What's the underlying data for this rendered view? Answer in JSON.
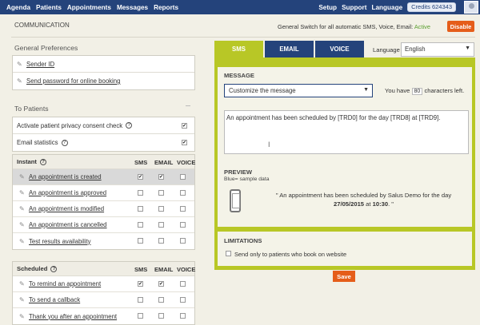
{
  "nav": {
    "left": [
      "Agenda",
      "Patients",
      "Appointments",
      "Messages",
      "Reports"
    ],
    "right": [
      "Setup",
      "Support",
      "Language"
    ],
    "credits": "Credits 624343"
  },
  "header": {
    "title": "COMMUNICATION",
    "switch_text": "General Switch for all automatic SMS, Voice, Email:",
    "switch_status": "Active",
    "disable_label": "Disable"
  },
  "general": {
    "title": "General Preferences",
    "items": [
      "Sender ID",
      "Send password for online booking"
    ]
  },
  "patients": {
    "title": "To Patients",
    "options": [
      {
        "label": "Activate patient privacy consent check",
        "checked": true
      },
      {
        "label": "Email statistics",
        "checked": true
      }
    ]
  },
  "instant": {
    "title": "Instant",
    "cols": [
      "SMS",
      "EMAIL",
      "VOICE"
    ],
    "rows": [
      {
        "label": "An appointment is created",
        "sms": true,
        "email": true,
        "voice": false
      },
      {
        "label": "An appointment is approved",
        "sms": false,
        "email": false,
        "voice": false
      },
      {
        "label": "An appointment is modified",
        "sms": false,
        "email": false,
        "voice": false
      },
      {
        "label": "An appointment is cancelled",
        "sms": false,
        "email": false,
        "voice": false
      },
      {
        "label": "Test results availability",
        "sms": false,
        "email": false,
        "voice": false
      }
    ]
  },
  "scheduled": {
    "title": "Scheduled",
    "cols": [
      "SMS",
      "EMAIL",
      "VOICE"
    ],
    "rows": [
      {
        "label": "To remind an appointment",
        "sms": true,
        "email": true,
        "voice": false
      },
      {
        "label": "To send a callback",
        "sms": false,
        "email": false,
        "voice": false
      },
      {
        "label": "Thank you after an appointment",
        "sms": false,
        "email": false,
        "voice": false
      }
    ]
  },
  "tabs": [
    "SMS",
    "EMAIL",
    "VOICE"
  ],
  "language": {
    "label": "Language",
    "value": "English"
  },
  "message": {
    "title": "MESSAGE",
    "select": "Customize the message",
    "chars_prefix": "You have",
    "chars_count": "80",
    "chars_suffix": "characters left.",
    "text": "An appointment has been scheduled by [TRD0] for the day [TRD8] at [TRD9]."
  },
  "preview": {
    "title": "PREVIEW",
    "subtitle": "Blue= sample data",
    "line1": "\" An appointment has been scheduled by Salus Demo for the day",
    "date": "27/05/2015",
    "at": "at",
    "time": "10:30",
    "end": ". \""
  },
  "limitations": {
    "title": "LIMITATIONS",
    "option": "Send only to patients who book on website"
  },
  "save_label": "Save"
}
